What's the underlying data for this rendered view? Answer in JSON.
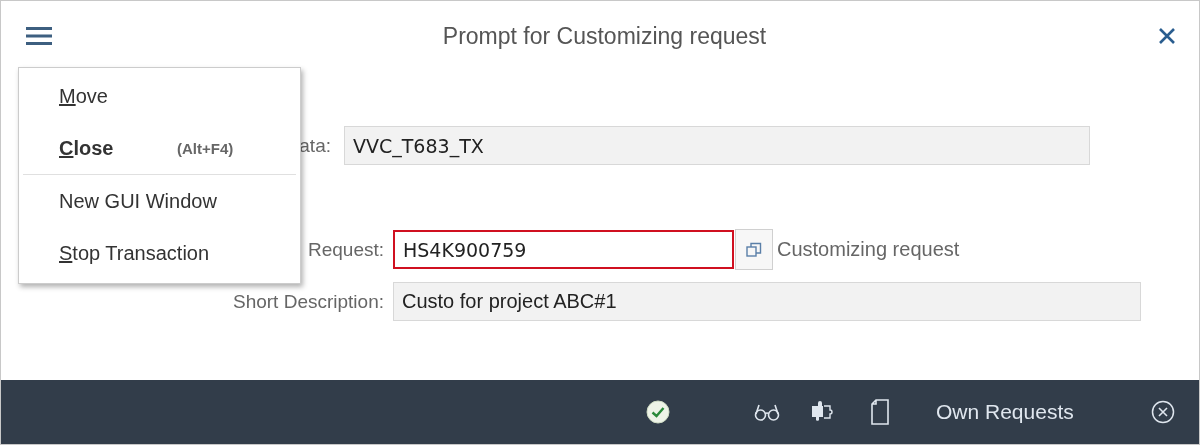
{
  "window": {
    "title": "Prompt for Customizing request"
  },
  "menu": {
    "items": [
      {
        "label": "Move",
        "mnemonic": true,
        "bold": false,
        "divider_after": false
      },
      {
        "label": "Close",
        "mnemonic": true,
        "bold": true,
        "shortcut": "(Alt+F4)",
        "divider_after": true
      },
      {
        "label": "New GUI Window",
        "mnemonic": false,
        "bold": false,
        "divider_after": false
      },
      {
        "label": "Stop Transaction",
        "mnemonic": true,
        "bold": false,
        "divider_after": false
      }
    ]
  },
  "form": {
    "rows": [
      {
        "label": "ata:",
        "value": "VVC_T683_TX",
        "editable": false,
        "error": false,
        "value_help": false,
        "description": null,
        "wide": false
      },
      {
        "label": "Request:",
        "value": "HS4K900759",
        "editable": true,
        "error": true,
        "value_help": true,
        "description": "Customizing request",
        "wide": false
      },
      {
        "label": "Short Description:",
        "value": "Custo for project ABC#1",
        "editable": false,
        "error": false,
        "value_help": false,
        "description": null,
        "wide": true
      }
    ]
  },
  "footer": {
    "buttons": [
      {
        "kind": "confirm"
      },
      {
        "kind": "display"
      },
      {
        "kind": "puzzle"
      },
      {
        "kind": "document"
      },
      {
        "kind": "text",
        "label": "Own Requests"
      },
      {
        "kind": "cancel"
      }
    ]
  }
}
